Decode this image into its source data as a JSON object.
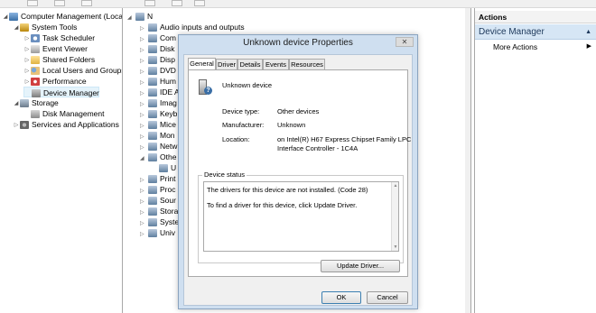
{
  "toolbar": {},
  "left_tree": {
    "items": [
      {
        "label": "Computer Management (Local",
        "expander": "◢",
        "icon": "computer-icon"
      },
      {
        "label": "System Tools",
        "expander": "◢",
        "icon": "tools-icon"
      },
      {
        "label": "Task Scheduler",
        "expander": "▷",
        "icon": "clock-icon"
      },
      {
        "label": "Event Viewer",
        "expander": "▷",
        "icon": "event-viewer-icon"
      },
      {
        "label": "Shared Folders",
        "expander": "▷",
        "icon": "folder-icon"
      },
      {
        "label": "Local Users and Groups",
        "expander": "▷",
        "icon": "users-icon"
      },
      {
        "label": "Performance",
        "expander": "▷",
        "icon": "performance-icon"
      },
      {
        "label": "Device Manager",
        "expander": "",
        "icon": "device-manager-icon"
      },
      {
        "label": "Storage",
        "expander": "◢",
        "icon": "storage-icon"
      },
      {
        "label": "Disk Management",
        "expander": "",
        "icon": "disk-icon"
      },
      {
        "label": "Services and Applications",
        "expander": "▷",
        "icon": "services-icon"
      }
    ]
  },
  "device_list": {
    "root_label": "N",
    "items": [
      {
        "label": "Audio inputs and outputs",
        "expander": "▷"
      },
      {
        "label": "Com",
        "expander": "▷"
      },
      {
        "label": "Disk",
        "expander": "▷"
      },
      {
        "label": "Disp",
        "expander": "▷"
      },
      {
        "label": "DVD",
        "expander": "▷"
      },
      {
        "label": "Hum",
        "expander": "▷"
      },
      {
        "label": "IDE A",
        "expander": "▷"
      },
      {
        "label": "Imag",
        "expander": "▷"
      },
      {
        "label": "Keyb",
        "expander": "▷"
      },
      {
        "label": "Mice",
        "expander": "▷"
      },
      {
        "label": "Mon",
        "expander": "▷"
      },
      {
        "label": "Netw",
        "expander": "▷"
      },
      {
        "label": "Othe",
        "expander": "◢"
      },
      {
        "label": "U",
        "expander": ""
      },
      {
        "label": "Print",
        "expander": "▷"
      },
      {
        "label": "Proc",
        "expander": "▷"
      },
      {
        "label": "Sour",
        "expander": "▷"
      },
      {
        "label": "Stora",
        "expander": "▷"
      },
      {
        "label": "Syste",
        "expander": "▷"
      },
      {
        "label": "Univ",
        "expander": "▷"
      }
    ]
  },
  "actions": {
    "header": "Actions",
    "selected": "Device Manager",
    "more": "More Actions"
  },
  "dialog": {
    "title": "Unknown device Properties",
    "close_glyph": "✕",
    "tabs": [
      "General",
      "Driver",
      "Details",
      "Events",
      "Resources"
    ],
    "device_name": "Unknown device",
    "device_type_label": "Device type:",
    "device_type_value": "Other devices",
    "manufacturer_label": "Manufacturer:",
    "manufacturer_value": "Unknown",
    "location_label": "Location:",
    "location_value_line1": "on Intel(R) H67 Express Chipset Family LPC",
    "location_value_line2": "Interface Controller - 1C4A",
    "status_group_label": "Device status",
    "status_line1": "The drivers for this device are not installed. (Code 28)",
    "status_line2": "To find a driver for this device, click Update Driver.",
    "update_driver_button": "Update Driver...",
    "ok_button": "OK",
    "cancel_button": "Cancel"
  }
}
